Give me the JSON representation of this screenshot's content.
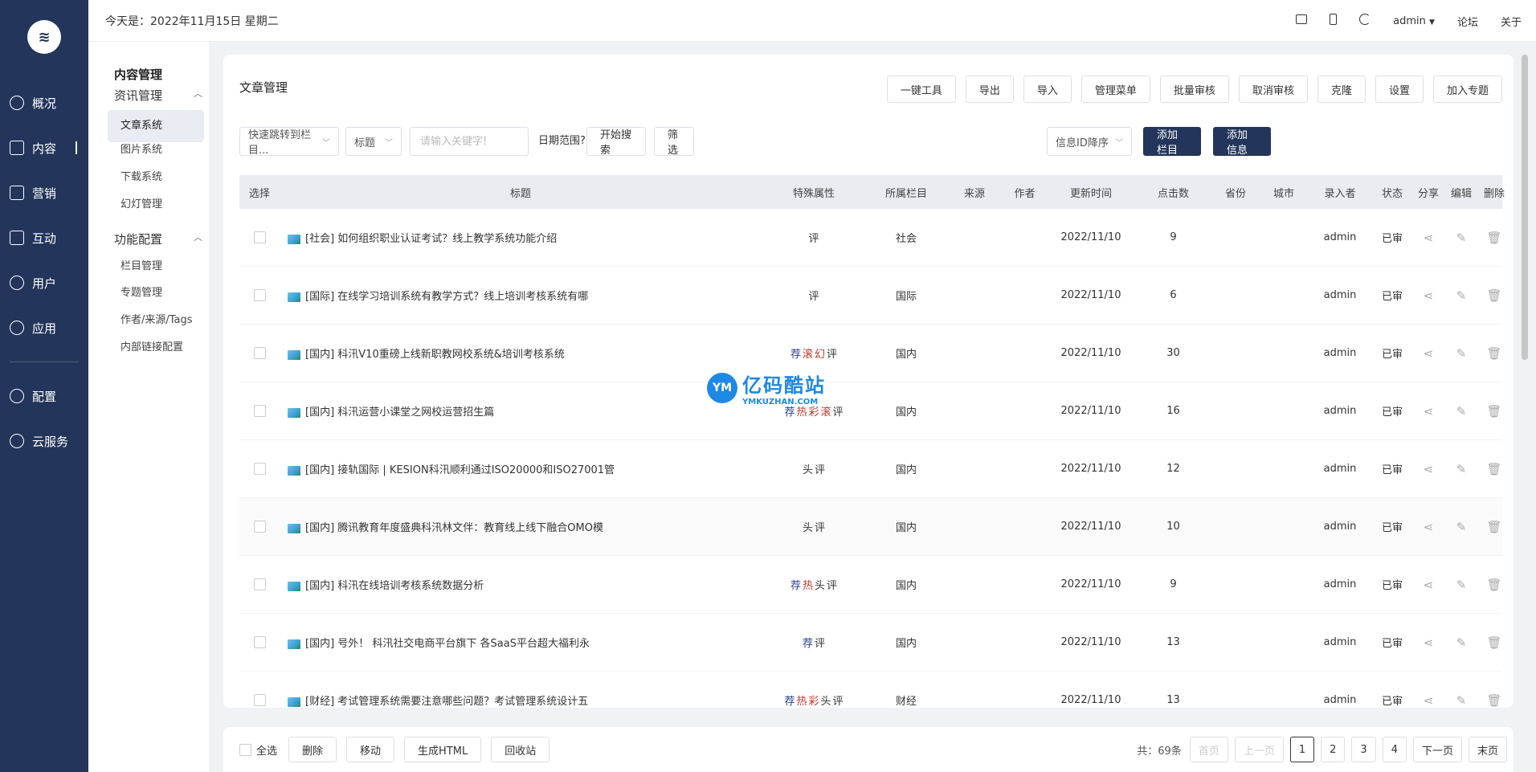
{
  "topbar": {
    "date": "今天是：2022年11月15日 星期二",
    "user": "admin",
    "forum": "论坛",
    "about": "关于"
  },
  "sidebar": {
    "items": [
      {
        "label": "概况",
        "icon": "clock-icon"
      },
      {
        "label": "内容",
        "icon": "book-icon"
      },
      {
        "label": "营销",
        "icon": "chart-icon"
      },
      {
        "label": "互动",
        "icon": "chat-icon"
      },
      {
        "label": "用户",
        "icon": "user-icon"
      },
      {
        "label": "应用",
        "icon": "cube-icon"
      }
    ],
    "bottom_items": [
      {
        "label": "配置",
        "icon": "gear-icon"
      },
      {
        "label": "云服务",
        "icon": "cloud-icon"
      }
    ]
  },
  "subnav": {
    "title": "内容管理",
    "group1": "资讯管理",
    "group1_items": [
      "文章系统",
      "图片系统",
      "下载系统",
      "幻灯管理"
    ],
    "group2": "功能配置",
    "group2_items": [
      "栏目管理",
      "专题管理",
      "作者/来源/Tags",
      "内部链接配置"
    ]
  },
  "main": {
    "title": "文章管理",
    "toolbar": [
      "一键工具",
      "导出",
      "导入",
      "管理菜单",
      "批量审核",
      "取消审核",
      "克隆",
      "设置",
      "加入专题"
    ],
    "filters": {
      "jump": "快速跳转到栏目...",
      "field": "标题",
      "keyword_placeholder": "请输入关键字!",
      "date_label": "日期范围?",
      "search": "开始搜索",
      "filter": "筛选",
      "sort": "信息ID降序",
      "add_column": "添加栏目",
      "add_info": "添加信息"
    },
    "table": {
      "headers": [
        "选择",
        "标题",
        "特殊属性",
        "所属栏目",
        "来源",
        "作者",
        "更新时间",
        "点击数",
        "省份",
        "城市",
        "录入者",
        "状态",
        "分享",
        "编辑",
        "删除"
      ],
      "rows": [
        {
          "title": "[社会] 如何组织职业认证考试？线上教学系统功能介绍",
          "attrs": [
            [
              "评",
              "a-ping"
            ]
          ],
          "column": "社会",
          "time": "2022/11/10",
          "hits": "9",
          "user": "admin",
          "status": "已审"
        },
        {
          "title": "[国际] 在线学习培训系统有教学方式？线上培训考核系统有哪",
          "attrs": [
            [
              "评",
              "a-ping"
            ]
          ],
          "column": "国际",
          "time": "2022/11/10",
          "hits": "6",
          "user": "admin",
          "status": "已审"
        },
        {
          "title": "[国内] 科汛V10重磅上线新职教网校系统&培训考核系统",
          "attrs": [
            [
              "荐",
              "a-tui"
            ],
            [
              "滚",
              "a-gun"
            ],
            [
              "幻",
              "a-huan"
            ],
            [
              "评",
              "a-ping"
            ]
          ],
          "column": "国内",
          "time": "2022/11/10",
          "hits": "30",
          "user": "admin",
          "status": "已审"
        },
        {
          "title": "[国内] 科汛运营小课堂之网校运营招生篇",
          "attrs": [
            [
              "荐",
              "a-tui"
            ],
            [
              "热",
              "a-re"
            ],
            [
              "彩",
              "a-cai"
            ],
            [
              "滚",
              "a-gun"
            ],
            [
              "评",
              "a-ping"
            ]
          ],
          "column": "国内",
          "time": "2022/11/10",
          "hits": "16",
          "user": "admin",
          "status": "已审"
        },
        {
          "title": "[国内] 接轨国际 | KESION科汛顺利通过ISO20000和ISO27001管",
          "attrs": [
            [
              "头",
              "a-tou"
            ],
            [
              "评",
              "a-ping"
            ]
          ],
          "column": "国内",
          "time": "2022/11/10",
          "hits": "12",
          "user": "admin",
          "status": "已审"
        },
        {
          "title": "[国内] 腾讯教育年度盛典科汛林文伴：教育线上线下融合OMO模",
          "attrs": [
            [
              "头",
              "a-tou"
            ],
            [
              "评",
              "a-ping"
            ]
          ],
          "column": "国内",
          "time": "2022/11/10",
          "hits": "10",
          "user": "admin",
          "status": "已审"
        },
        {
          "title": "[国内] 科汛在线培训考核系统数据分析",
          "attrs": [
            [
              "荐",
              "a-tui"
            ],
            [
              "热",
              "a-re"
            ],
            [
              "头",
              "a-tou"
            ],
            [
              "评",
              "a-ping"
            ]
          ],
          "column": "国内",
          "time": "2022/11/10",
          "hits": "9",
          "user": "admin",
          "status": "已审"
        },
        {
          "title": "[国内] 号外！ 科汛社交电商平台旗下 各SaaS平台超大福利永",
          "attrs": [
            [
              "荐",
              "a-tui"
            ],
            [
              "评",
              "a-ping"
            ]
          ],
          "column": "国内",
          "time": "2022/11/10",
          "hits": "13",
          "user": "admin",
          "status": "已审"
        },
        {
          "title": "[财经] 考试管理系统需要注意哪些问题？考试管理系统设计五",
          "attrs": [
            [
              "荐",
              "a-tui"
            ],
            [
              "热",
              "a-re"
            ],
            [
              "彩",
              "a-cai"
            ],
            [
              "头",
              "a-tou"
            ],
            [
              "评",
              "a-ping"
            ]
          ],
          "column": "财经",
          "time": "2022/11/10",
          "hits": "13",
          "user": "admin",
          "status": "已审"
        }
      ]
    }
  },
  "bottom": {
    "select_all": "全选",
    "actions": [
      "删除",
      "移动",
      "生成HTML",
      "回收站"
    ],
    "total": "共：69条",
    "first": "首页",
    "prev": "上一页",
    "pages": [
      "1",
      "2",
      "3",
      "4"
    ],
    "next": "下一页",
    "last": "末页"
  },
  "watermark": {
    "logo": "YM",
    "name": "亿码酷站",
    "url": "YMKUZHAN.COM"
  }
}
